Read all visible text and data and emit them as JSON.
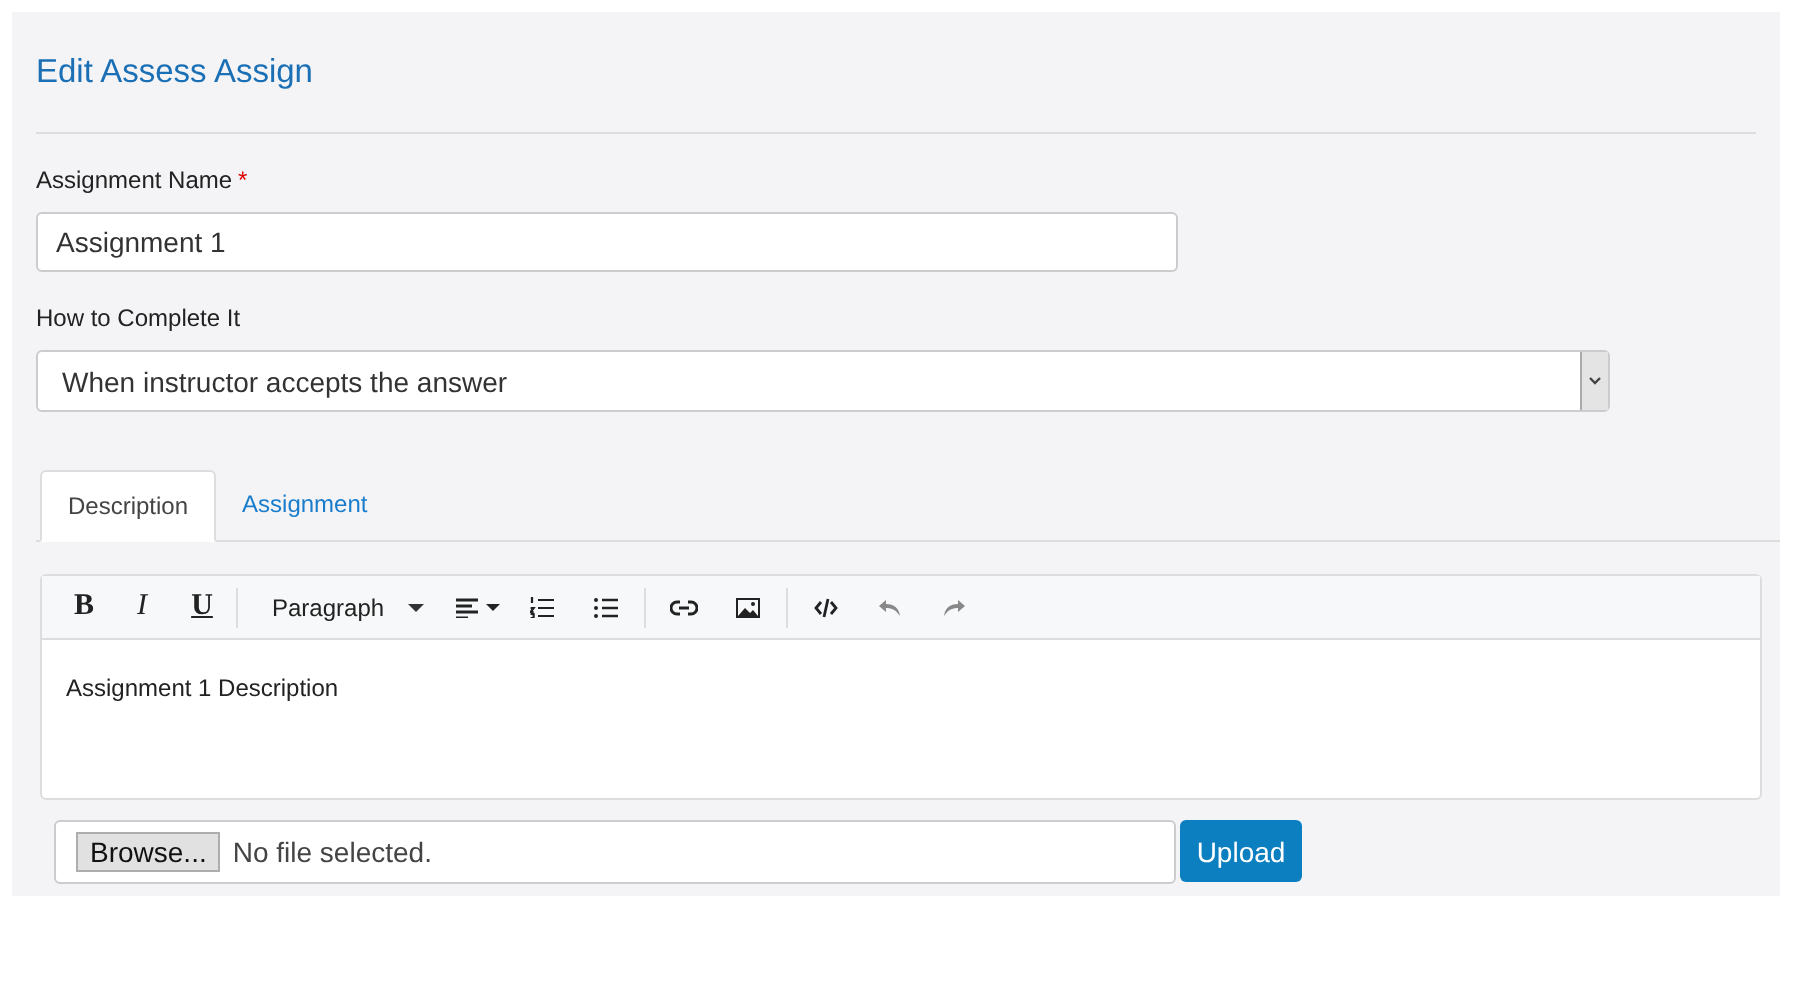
{
  "title": "Edit Assess Assign",
  "name_field": {
    "label": "Assignment Name",
    "required_mark": "*",
    "value": "Assignment 1"
  },
  "complete_field": {
    "label": "How to Complete It",
    "value": "When instructor accepts the answer"
  },
  "tabs": [
    {
      "label": "Description",
      "selected": true
    },
    {
      "label": "Assignment",
      "selected": false
    }
  ],
  "toolbar": [
    {
      "kind": "bold",
      "label": "B",
      "disabled": false
    },
    {
      "kind": "italic",
      "label": "I",
      "disabled": false
    },
    {
      "kind": "underline",
      "label": "U",
      "disabled": false
    },
    {
      "kind": "separator"
    },
    {
      "kind": "dropdown",
      "label": "Paragraph",
      "disabled": false
    },
    {
      "kind": "align",
      "disabled": false
    },
    {
      "kind": "ordered-list",
      "disabled": false
    },
    {
      "kind": "bullet-list",
      "disabled": false
    },
    {
      "kind": "separator"
    },
    {
      "kind": "link",
      "disabled": false
    },
    {
      "kind": "image",
      "disabled": false
    },
    {
      "kind": "separator"
    },
    {
      "kind": "code",
      "disabled": false
    },
    {
      "kind": "undo",
      "disabled": true
    },
    {
      "kind": "redo",
      "disabled": true
    }
  ],
  "editor_text": "Assignment 1 Description",
  "file": {
    "button": "Browse...",
    "status": "No file selected.",
    "upload": "Upload"
  }
}
